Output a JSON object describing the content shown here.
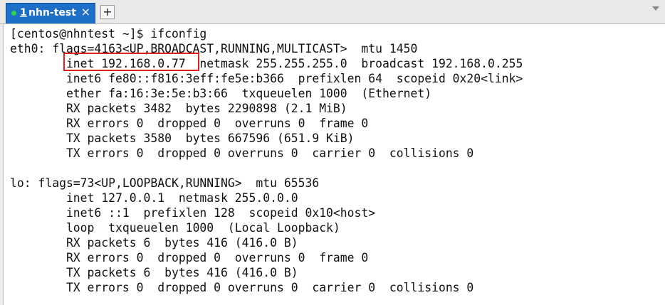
{
  "tab": {
    "number": "1",
    "title": "nhn-test",
    "close": "×",
    "new_tab": "+"
  },
  "terminal": {
    "lines": [
      "[centos@nhntest ~]$ ifconfig",
      "eth0: flags=4163<UP,BROADCAST,RUNNING,MULTICAST>  mtu 1450",
      "        inet 192.168.0.77  netmask 255.255.255.0  broadcast 192.168.0.255",
      "        inet6 fe80::f816:3eff:fe5e:b366  prefixlen 64  scopeid 0x20<link>",
      "        ether fa:16:3e:5e:b3:66  txqueuelen 1000  (Ethernet)",
      "        RX packets 3482  bytes 2290898 (2.1 MiB)",
      "        RX errors 0  dropped 0  overruns 0  frame 0",
      "        TX packets 3580  bytes 667596 (651.9 KiB)",
      "        TX errors 0  dropped 0 overruns 0  carrier 0  collisions 0",
      "",
      "lo: flags=73<UP,LOOPBACK,RUNNING>  mtu 65536",
      "        inet 127.0.0.1  netmask 255.0.0.0",
      "        inet6 ::1  prefixlen 128  scopeid 0x10<host>",
      "        loop  txqueuelen 1000  (Local Loopback)",
      "        RX packets 6  bytes 416 (416.0 B)",
      "        RX errors 0  dropped 0  overruns 0  frame 0",
      "        TX packets 6  bytes 416 (416.0 B)",
      "        TX errors 0  dropped 0 overruns 0  carrier 0  collisions 0"
    ]
  },
  "colors": {
    "tab_active": "#1e6fc8",
    "status_dot": "#2bd94a",
    "highlight": "#e02020",
    "terminal_bg": "#ffffff",
    "terminal_fg": "#111111"
  }
}
